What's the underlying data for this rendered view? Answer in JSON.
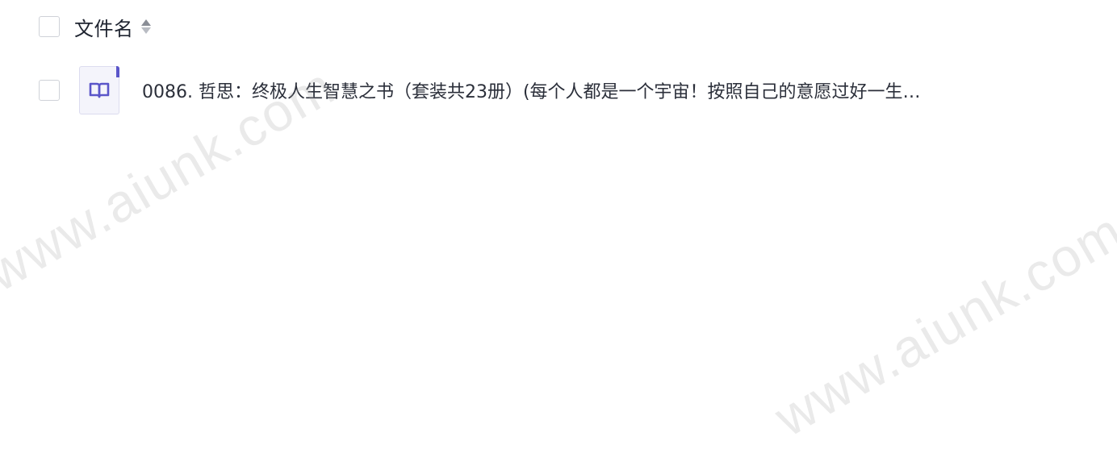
{
  "header": {
    "column_label": "文件名",
    "sort_icon": "sort-icon"
  },
  "files": [
    {
      "name": "0086. 哲思：终极人生智慧之书（套装共23册）(每个人都是一个宇宙！按照自己的意愿过好一生…",
      "icon": "book-icon"
    }
  ],
  "watermark": {
    "text": "www.aiunk.com"
  },
  "colors": {
    "icon_accent": "#5a55c9",
    "icon_bg": "#f4f4fb"
  }
}
